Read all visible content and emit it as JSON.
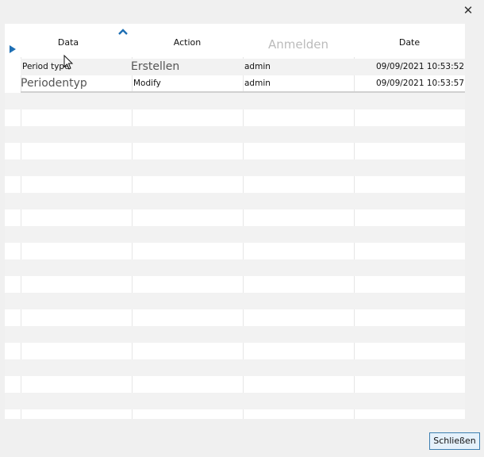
{
  "dialog": {
    "close_glyph": "✕",
    "close_button": "Schließen"
  },
  "grid": {
    "columns": [
      {
        "label": "Data"
      },
      {
        "label": "Action"
      },
      {
        "label": "Anmelden"
      },
      {
        "label": "Date"
      }
    ],
    "rows": [
      {
        "data": "Period type",
        "action": "Erstellen",
        "login": "admin",
        "date": "09/09/2021 10:53:52"
      },
      {
        "data": "Periodentyp",
        "action": "Modify",
        "login": "admin",
        "date": "09/09/2021 10:53:57"
      }
    ],
    "sort_icon": "chevron-up-icon",
    "row_indicator_icon": "play-right-icon",
    "colors": {
      "indicator": "#1e6fb4",
      "sort": "#1e6fb4",
      "button_border": "#3c7fb1",
      "button_bg": "#e5f1fb"
    }
  }
}
